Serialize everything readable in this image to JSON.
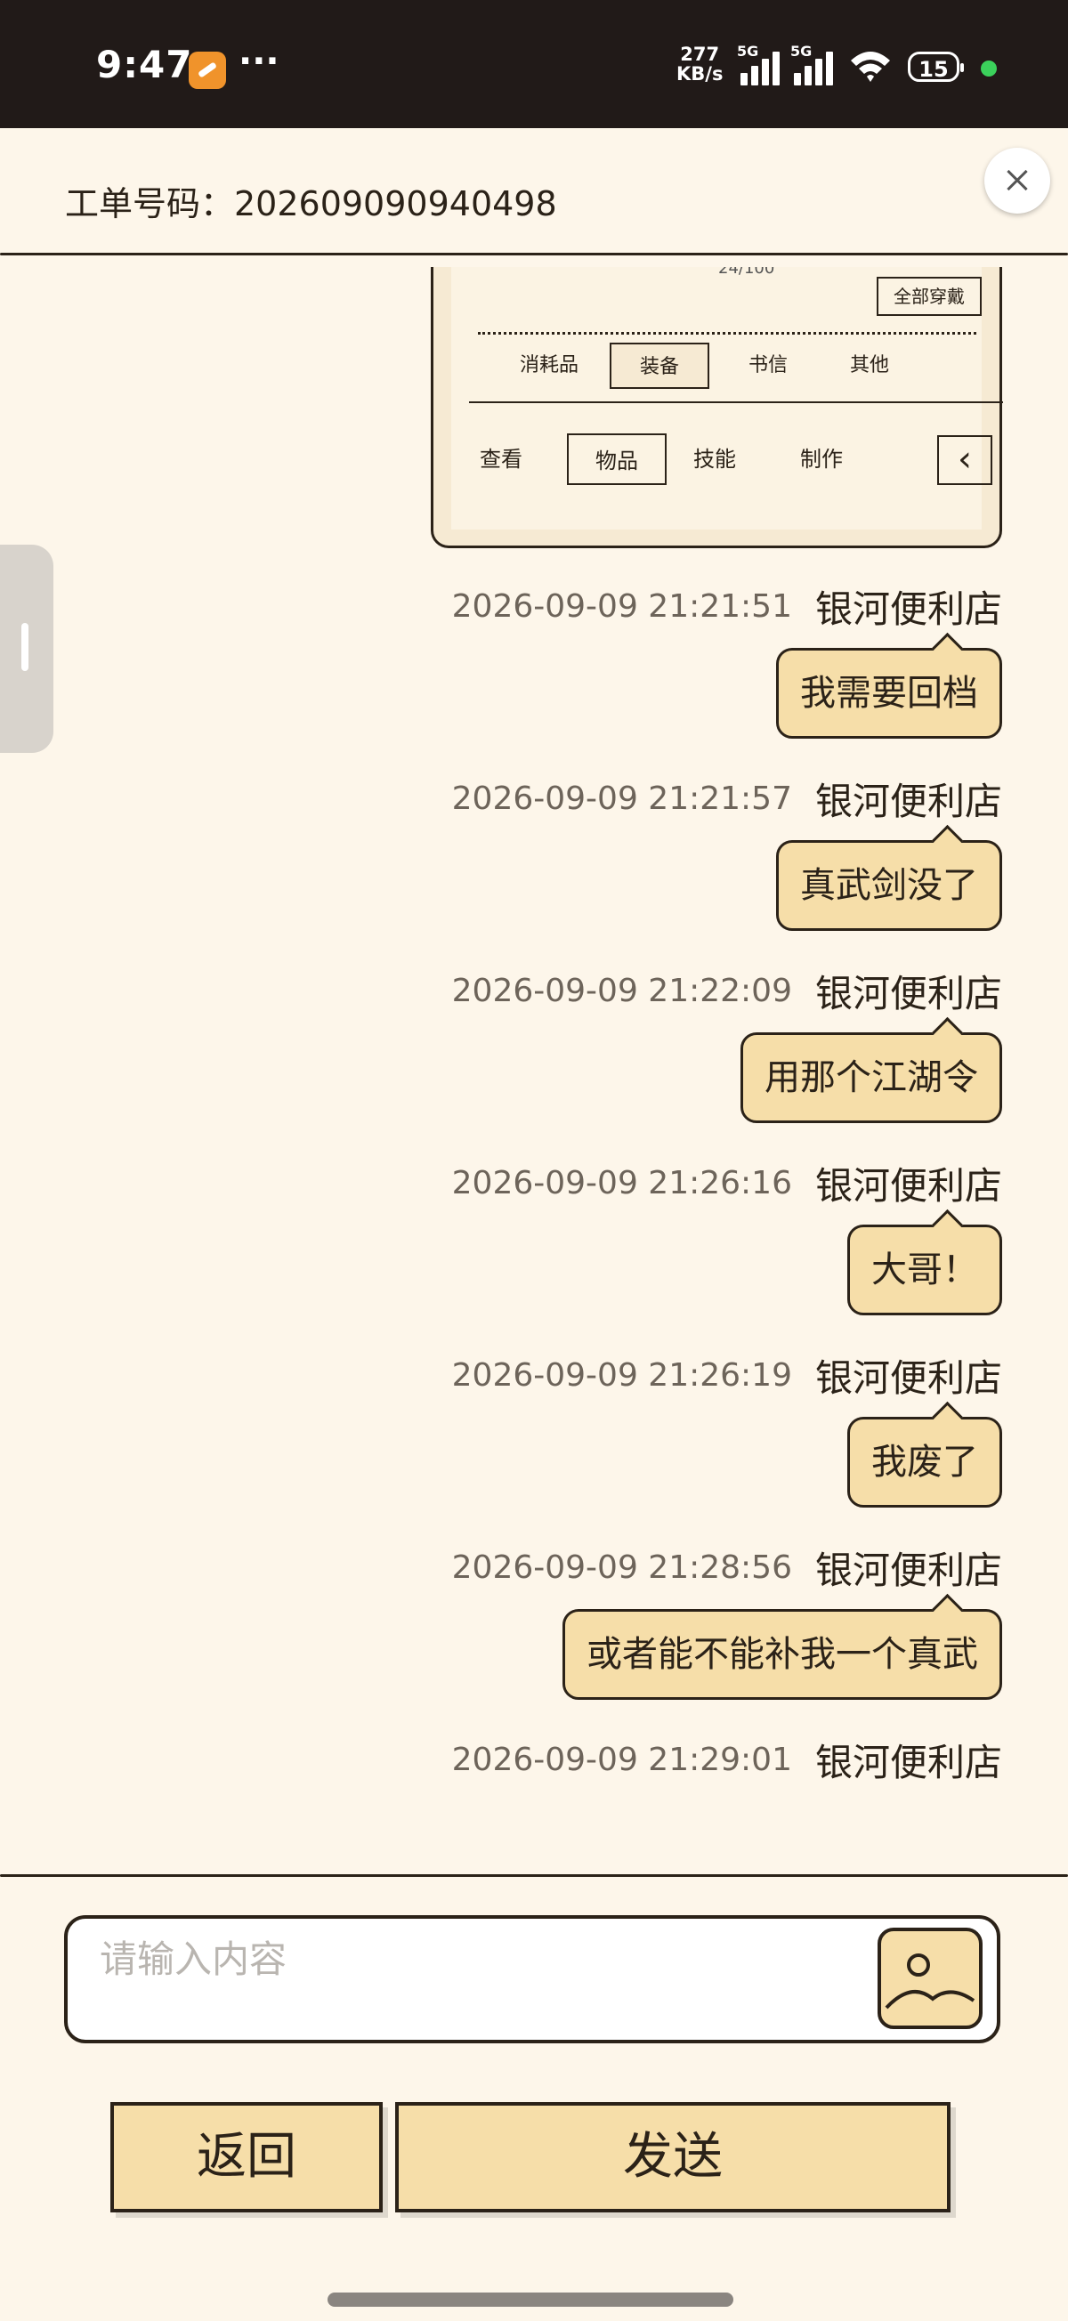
{
  "status_bar": {
    "time": "9:47",
    "more": "···",
    "net_speed_value": "277",
    "net_speed_unit": "KB/s",
    "sig1_label": "5G",
    "sig2_label": "5G",
    "battery": "15"
  },
  "header": {
    "ticket_label": "工单号码：202609090940498"
  },
  "screenshot": {
    "counter": "24/100",
    "wear_all": "全部穿戴",
    "tabs": [
      "消耗品",
      "装备",
      "书信",
      "其他"
    ],
    "nav": [
      "查看",
      "物品",
      "技能",
      "制作"
    ],
    "back_glyph": "‹"
  },
  "messages": [
    {
      "time": "2026-09-09 21:21:51",
      "sender": "银河便利店",
      "text": "我需要回档"
    },
    {
      "time": "2026-09-09 21:21:57",
      "sender": "银河便利店",
      "text": "真武剑没了"
    },
    {
      "time": "2026-09-09 21:22:09",
      "sender": "银河便利店",
      "text": "用那个江湖令"
    },
    {
      "time": "2026-09-09 21:26:16",
      "sender": "银河便利店",
      "text": "大哥！"
    },
    {
      "time": "2026-09-09 21:26:19",
      "sender": "银河便利店",
      "text": "我废了"
    },
    {
      "time": "2026-09-09 21:28:56",
      "sender": "银河便利店",
      "text": "或者能不能补我一个真武"
    },
    {
      "time": "2026-09-09 21:29:01",
      "sender": "银河便利店"
    }
  ],
  "composer": {
    "placeholder": "请输入内容"
  },
  "buttons": {
    "back": "返回",
    "send": "发送"
  }
}
